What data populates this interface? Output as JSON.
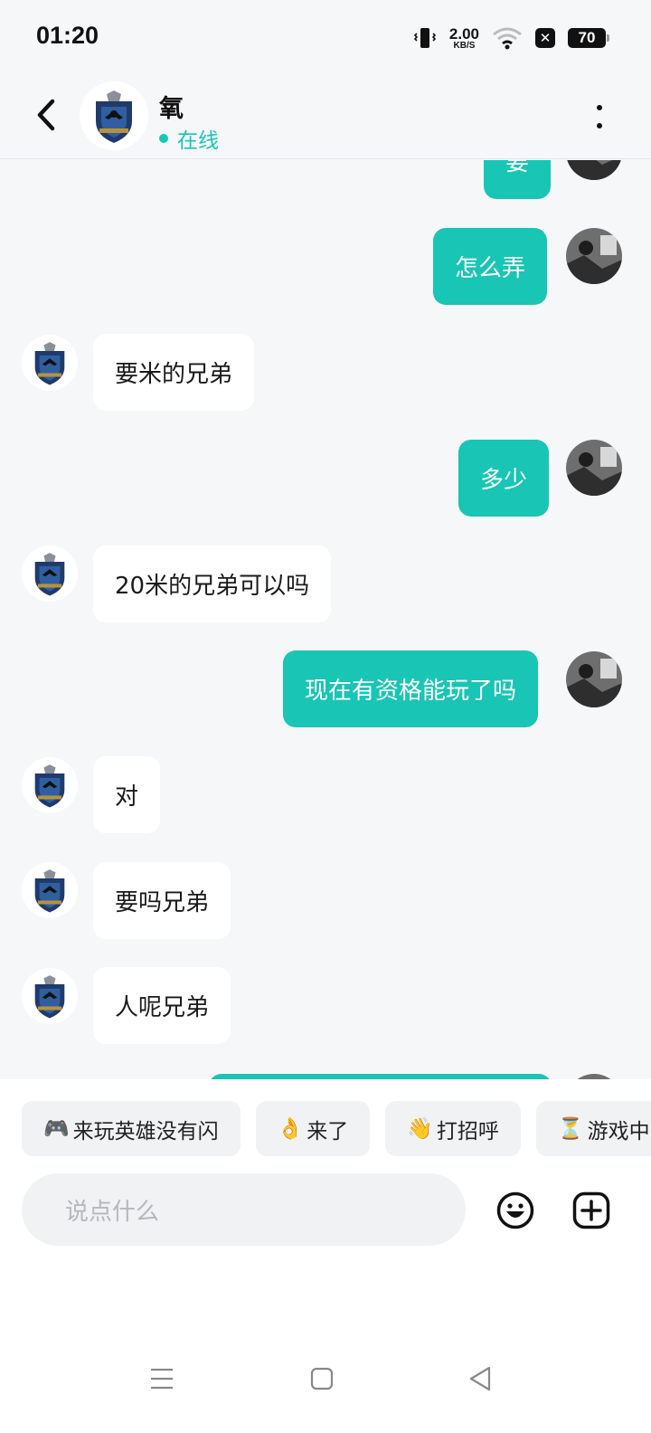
{
  "status_bar": {
    "time": "01:20",
    "net_speed_value": "2.00",
    "net_speed_unit": "KB/S",
    "battery": "70",
    "icons": [
      "vibrate-icon",
      "wifi-icon",
      "close-badge-icon",
      "battery-icon"
    ]
  },
  "header": {
    "contact_name": "氧",
    "online_status": "在线",
    "icons": [
      "back-arrow-icon",
      "more-vertical-icon"
    ]
  },
  "messages": [
    {
      "side": "out",
      "text": "要"
    },
    {
      "side": "out",
      "text": "怎么弄"
    },
    {
      "side": "in",
      "text": "要米的兄弟"
    },
    {
      "side": "out",
      "text": "多少"
    },
    {
      "side": "in",
      "text": "20米的兄弟可以吗"
    },
    {
      "side": "out",
      "text": "现在有资格能玩了吗"
    },
    {
      "side": "in",
      "text": "对"
    },
    {
      "side": "in",
      "text": "要吗兄弟"
    },
    {
      "side": "in",
      "text": "人呢兄弟"
    }
  ],
  "quick_replies": [
    {
      "emoji": "🎮",
      "label": " 来玩英雄没有闪"
    },
    {
      "emoji": "👌",
      "label": "来了"
    },
    {
      "emoji": "👋",
      "label": "打招呼"
    },
    {
      "emoji": "⏳",
      "label": "游戏中"
    }
  ],
  "composer": {
    "placeholder": "说点什么",
    "icons": [
      "emoji-icon",
      "add-icon"
    ]
  },
  "nav_bar": {
    "icons": [
      "menu-icon",
      "home-icon",
      "back-icon"
    ]
  },
  "colors": {
    "accent": "#19c5b4",
    "background": "#f6f7f9",
    "incoming_bubble": "#ffffff"
  }
}
